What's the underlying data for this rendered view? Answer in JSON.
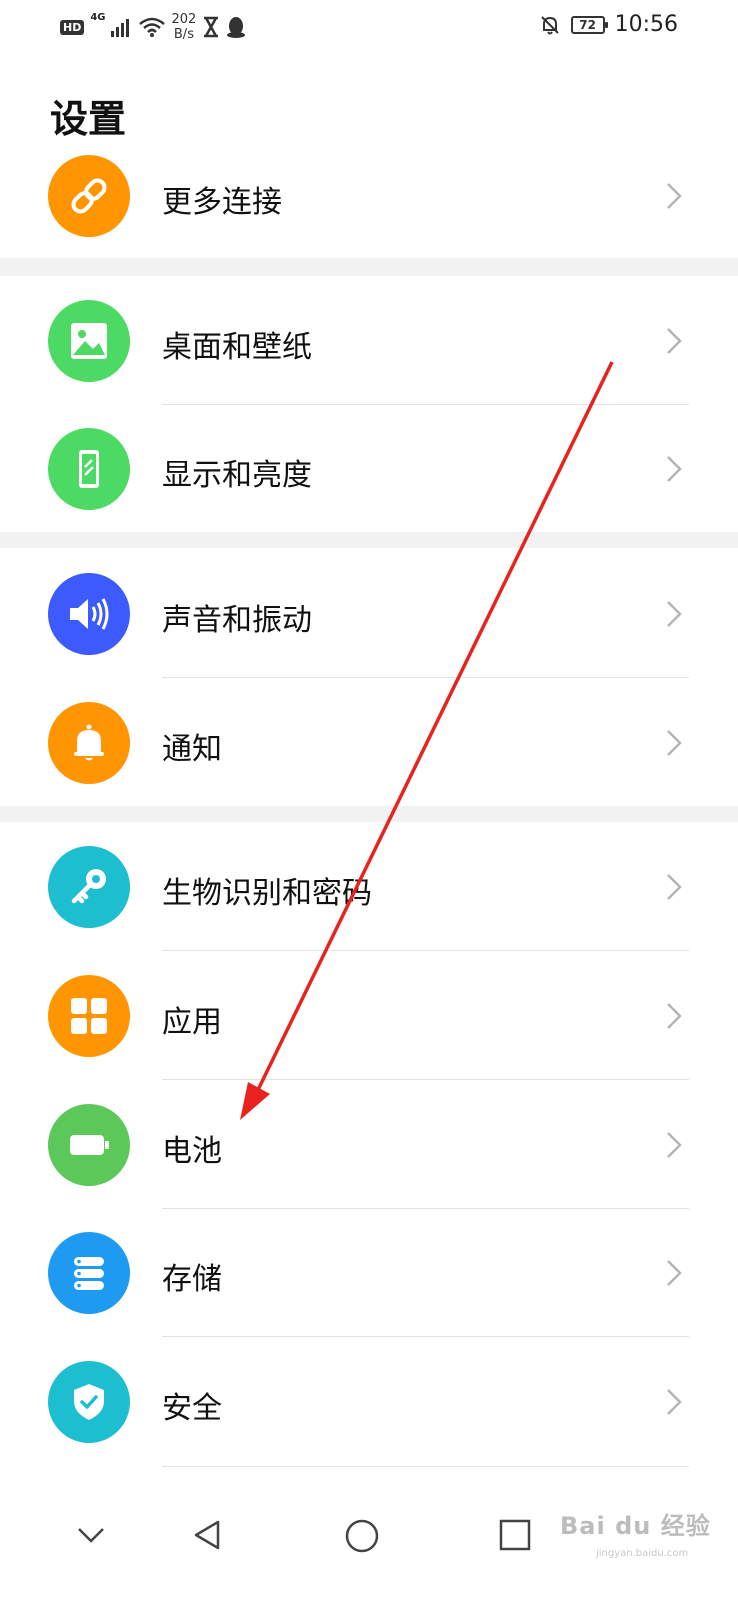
{
  "status_bar": {
    "hd": "HD",
    "network": "4G",
    "speed_value": "202",
    "speed_unit": "B/s",
    "battery": "72",
    "time": "10:56"
  },
  "title": "设置",
  "items": [
    {
      "label": "更多连接",
      "icon": "link-icon",
      "color": "#FF9500"
    },
    {
      "label": "桌面和壁纸",
      "icon": "picture-icon",
      "color": "#4CD964"
    },
    {
      "label": "显示和亮度",
      "icon": "display-phone-icon",
      "color": "#4CD964"
    },
    {
      "label": "声音和振动",
      "icon": "speaker-icon",
      "color": "#3D5AFE"
    },
    {
      "label": "通知",
      "icon": "bell-icon",
      "color": "#FF9500"
    },
    {
      "label": "生物识别和密码",
      "icon": "key-icon",
      "color": "#1EBED1"
    },
    {
      "label": "应用",
      "icon": "apps-grid-icon",
      "color": "#FF9500"
    },
    {
      "label": "电池",
      "icon": "battery-icon",
      "color": "#5CC85A"
    },
    {
      "label": "存储",
      "icon": "storage-icon",
      "color": "#1E9BF0"
    },
    {
      "label": "安全",
      "icon": "shield-check-icon",
      "color": "#1EBED1"
    }
  ],
  "watermark": {
    "text": "Bai du 经验",
    "sub": "jingyan.baidu.com"
  }
}
